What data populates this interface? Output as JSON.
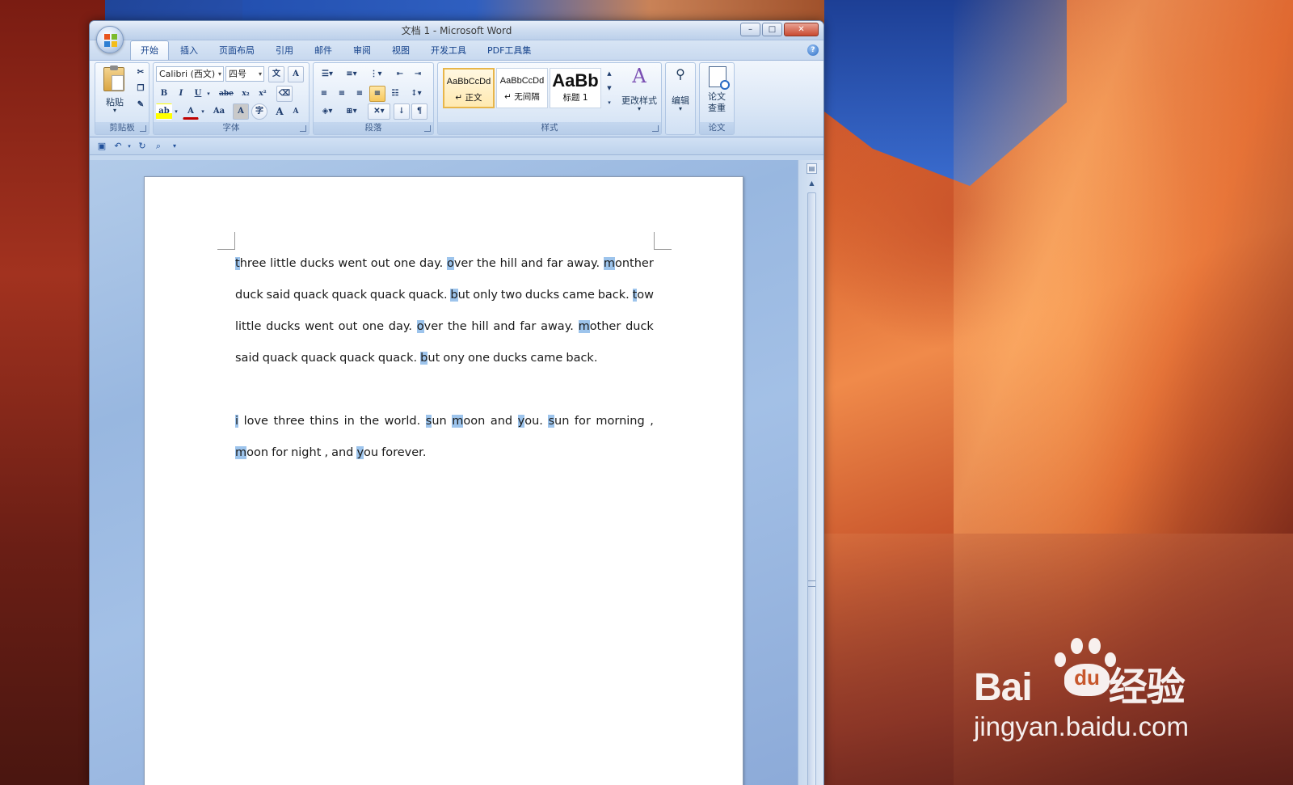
{
  "window": {
    "title": "文档 1 - Microsoft Word",
    "controls": {
      "minimize": "–",
      "maximize": "□",
      "close": "✕"
    }
  },
  "tabs": [
    "开始",
    "插入",
    "页面布局",
    "引用",
    "邮件",
    "审阅",
    "视图",
    "开发工具",
    "PDF工具集"
  ],
  "active_tab": "开始",
  "ribbon": {
    "clipboard": {
      "label": "剪贴板",
      "paste_label": "粘贴"
    },
    "font": {
      "label": "字体",
      "font_name": "Calibri (西文)",
      "font_size": "四号",
      "bold": "B",
      "italic": "I",
      "underline": "U",
      "strike": "abe",
      "subscript": "x₂",
      "superscript": "x²",
      "change_case": "Aa",
      "grow_font": "A",
      "shrink_font": "A"
    },
    "paragraph": {
      "label": "段落"
    },
    "styles": {
      "label": "样式",
      "items": [
        {
          "sample": "AaBbCcDd",
          "name": "↵ 正文"
        },
        {
          "sample": "AaBbCcDd",
          "name": "↵ 无间隔"
        },
        {
          "sample": "AaBb",
          "name": "标题 1"
        }
      ],
      "change_styles": "更改样式"
    },
    "editing": {
      "label": "编辑"
    },
    "paper": {
      "label": "论文",
      "check_label_1": "论文",
      "check_label_2": "查重"
    }
  },
  "document": {
    "paragraphs": [
      {
        "lines": [
          [
            [
              "",
              "t",
              "hree"
            ],
            [
              "little"
            ],
            [
              "ducks"
            ],
            [
              "went"
            ],
            [
              "out"
            ],
            [
              "one"
            ],
            [
              "day."
            ],
            [
              "",
              "o",
              "ver"
            ],
            [
              "the"
            ],
            [
              "hill"
            ],
            [
              "and"
            ],
            [
              "far"
            ],
            [
              "away."
            ],
            [
              "",
              "m",
              "onther"
            ]
          ],
          [
            [
              "duck"
            ],
            [
              "said"
            ],
            [
              "quack"
            ],
            [
              "quack"
            ],
            [
              "quack"
            ],
            [
              "quack."
            ],
            [
              "",
              "b",
              "ut"
            ],
            [
              "only"
            ],
            [
              "two"
            ],
            [
              "ducks"
            ],
            [
              "came"
            ],
            [
              "back."
            ],
            [
              "",
              "t",
              "ow"
            ]
          ],
          [
            [
              "little"
            ],
            [
              "ducks"
            ],
            [
              "went"
            ],
            [
              "out"
            ],
            [
              "one"
            ],
            [
              "day."
            ],
            [
              "",
              "o",
              "ver"
            ],
            [
              "the"
            ],
            [
              "hill"
            ],
            [
              "and"
            ],
            [
              "far"
            ],
            [
              "away."
            ],
            [
              "",
              "m",
              "other"
            ],
            [
              "duck"
            ]
          ],
          [
            [
              "said"
            ],
            [
              "quack"
            ],
            [
              "quack"
            ],
            [
              "quack"
            ],
            [
              "quack."
            ],
            [
              "",
              "b",
              "ut"
            ],
            [
              "ony"
            ],
            [
              "one"
            ],
            [
              "ducks"
            ],
            [
              "came"
            ],
            [
              "back."
            ]
          ]
        ],
        "last_line_left": true
      },
      {
        "lines": [
          [
            [
              "",
              "i",
              ""
            ],
            [
              "love"
            ],
            [
              "three"
            ],
            [
              "thins"
            ],
            [
              "in"
            ],
            [
              "the"
            ],
            [
              "world."
            ],
            [
              "",
              "s",
              "un"
            ],
            [
              "",
              "m",
              "oon"
            ],
            [
              "and"
            ],
            [
              "",
              "y",
              "ou."
            ],
            [
              "",
              "s",
              "un"
            ],
            [
              "for"
            ],
            [
              "morning"
            ],
            [
              ","
            ]
          ],
          [
            [
              "",
              "m",
              "oon"
            ],
            [
              "for"
            ],
            [
              "night"
            ],
            [
              ","
            ],
            [
              "and"
            ],
            [
              "",
              "y",
              "ou"
            ],
            [
              "forever."
            ]
          ]
        ],
        "last_line_left": true
      }
    ]
  },
  "watermark": {
    "brand": "Bai",
    "brand_suffix": "经验",
    "paw_text": "du",
    "url": "jingyan.baidu.com"
  }
}
